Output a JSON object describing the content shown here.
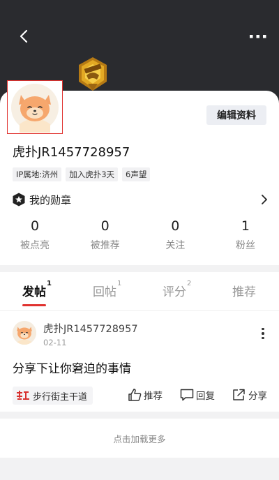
{
  "header": {
    "back_icon": "chevron-left-icon",
    "more_icon": "ellipsis-icon",
    "medal_badge_icon": "gold-medal-badge-icon"
  },
  "profile": {
    "username": "虎扑JR1457728957",
    "edit_label": "编辑资料",
    "tags": [
      "IP属地:济州",
      "加入虎扑3天",
      "6声望"
    ],
    "medal_label": "我的勋章",
    "stats": [
      {
        "num": "0",
        "label": "被点亮"
      },
      {
        "num": "0",
        "label": "被推荐"
      },
      {
        "num": "0",
        "label": "关注"
      },
      {
        "num": "1",
        "label": "粉丝"
      }
    ]
  },
  "tabs": [
    {
      "label": "发帖",
      "count": "1",
      "active": true
    },
    {
      "label": "回帖",
      "count": "1",
      "active": false
    },
    {
      "label": "评分",
      "count": "2",
      "active": false
    },
    {
      "label": "推荐",
      "count": "",
      "active": false
    }
  ],
  "post": {
    "author": "虎扑JR1457728957",
    "date": "02-11",
    "title": "分享下让你窘迫的事情",
    "forum": "步行街主干道",
    "actions": {
      "recommend": "推荐",
      "reply": "回复",
      "share": "分享"
    }
  },
  "load_more": "点击加载更多",
  "colors": {
    "accent": "#e0322f",
    "header_bg": "#2a2b2f",
    "page_bg": "#f2f2f3"
  }
}
